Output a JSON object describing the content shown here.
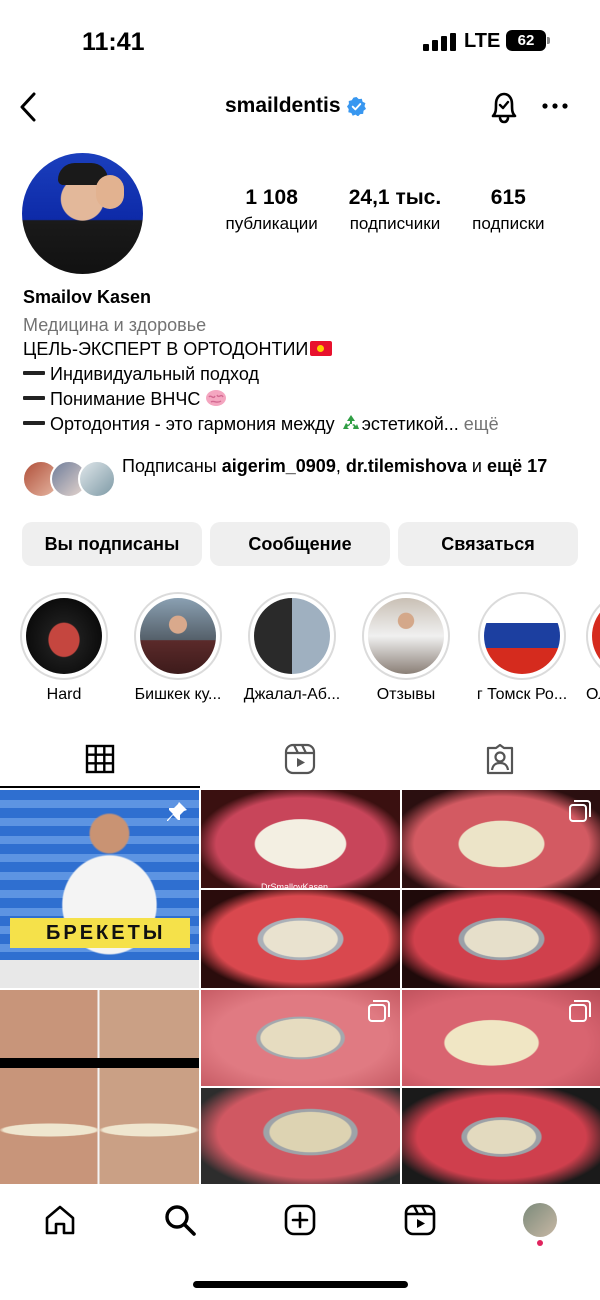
{
  "status_bar": {
    "time": "11:41",
    "network": "LTE",
    "battery": "62"
  },
  "header": {
    "username": "smaildentis",
    "verified": true,
    "back_icon": "chevron-left-icon",
    "bell_icon": "bell-icon",
    "more_icon": "more-icon"
  },
  "stats": [
    {
      "value": "1 108",
      "label": "публикации"
    },
    {
      "value": "24,1 тыс.",
      "label": "подписчики"
    },
    {
      "value": "615",
      "label": "подписки"
    }
  ],
  "bio": {
    "name": "Smailov Kasen",
    "category": "Медицина и здоровье",
    "line1": "ЦЕЛЬ-ЭКСПЕРТ В ОРТОДОНТИИ",
    "line2": "Индивидуальный подход",
    "line3": "Понимание ВНЧС",
    "line4": "Ортодонтия - это гармония между",
    "line4b": "эстетикой...",
    "more": "ещё"
  },
  "followed_by": {
    "prefix": "Подписаны ",
    "user1": "aigerim_0909",
    "sep": ", ",
    "user2": "dr.tilemishova",
    "suffix": " и ",
    "more": "ещё 17"
  },
  "buttons": {
    "following": "Вы подписаны",
    "message": "Сообщение",
    "contact": "Связаться"
  },
  "highlights": [
    {
      "label": "Hard"
    },
    {
      "label": "Бишкек ку..."
    },
    {
      "label": "Джалал-Аб..."
    },
    {
      "label": "Отзывы"
    },
    {
      "label": "г Томск Ро..."
    },
    {
      "label": "Ол"
    }
  ],
  "tabs": {
    "posts_icon": "grid-icon",
    "reels_icon": "reels-icon",
    "tagged_icon": "tagged-icon"
  },
  "posts": {
    "pinned_label": "БРЕКЕТЫ",
    "watermark": "DrSmallovKasen"
  },
  "bottom_nav": {
    "home_icon": "home-icon",
    "search_icon": "search-icon",
    "create_icon": "create-icon",
    "reels_icon": "reels-icon",
    "profile_icon": "profile-avatar"
  },
  "colors": {
    "verified_blue": "#3897f0",
    "notification_dot": "#e0245e",
    "button_bg": "#efefef",
    "secondary_text": "#737373"
  }
}
